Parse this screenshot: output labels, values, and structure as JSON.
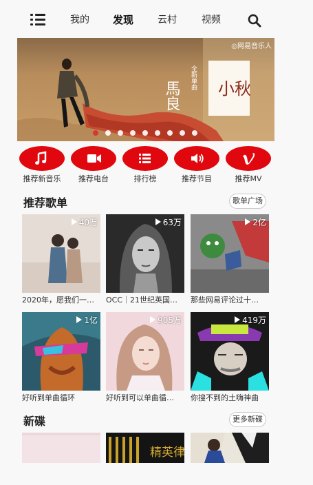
{
  "nav": {
    "menu_icon": "list-icon",
    "tabs": [
      {
        "label": "我的",
        "active": false
      },
      {
        "label": "发现",
        "active": true
      },
      {
        "label": "云村",
        "active": false
      },
      {
        "label": "视频",
        "active": false
      }
    ],
    "search_icon": "search-icon"
  },
  "banner": {
    "watermark": "◎网易音乐人",
    "artist_text": "馬良",
    "subtitle_text": "全新单曲",
    "title_text": "小秋",
    "dot_count": 9,
    "active_dot": 0
  },
  "categories": [
    {
      "label": "推荐新音乐",
      "icon": "music-note-icon"
    },
    {
      "label": "推荐电台",
      "icon": "video-camera-icon"
    },
    {
      "label": "排行榜",
      "icon": "ranking-list-icon"
    },
    {
      "label": "推荐节目",
      "icon": "speaker-icon"
    },
    {
      "label": "推荐MV",
      "icon": "vimeo-icon"
    }
  ],
  "recommend": {
    "title": "推荐歌单",
    "more_label": "歌单广场",
    "playlists": [
      {
        "title": "2020年，愿我们一…",
        "plays": "40万"
      },
      {
        "title": "OCC｜21世纪英国…",
        "plays": "63万"
      },
      {
        "title": "那些网易评论过十…",
        "plays": "2亿"
      },
      {
        "title": "好听到单曲循环",
        "plays": "1亿"
      },
      {
        "title": "好听到可以单曲循…",
        "plays": "905万"
      },
      {
        "title": "你搜不到的土嗨神曲",
        "plays": "419万"
      }
    ]
  },
  "new_albums": {
    "title": "新碟",
    "more_label": "更多新碟",
    "album2_text": "精英律师"
  },
  "colors": {
    "accent_red": "#e0070f",
    "background": "#f8f8f8"
  }
}
